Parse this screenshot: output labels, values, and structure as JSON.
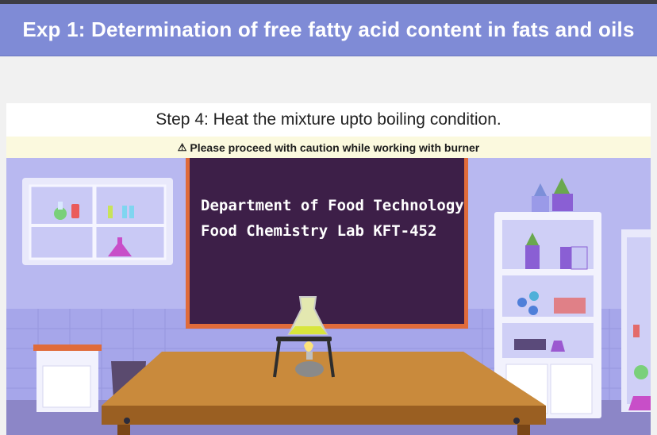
{
  "header": {
    "title": "Exp 1: Determination of free fatty acid content in fats and oils"
  },
  "step": {
    "text": "Step 4: Heat the mixture upto boiling condition."
  },
  "warning": {
    "icon": "warning-triangle-icon",
    "text": "Please proceed with caution while working with burner"
  },
  "chalkboard": {
    "line1": "Department of Food Technology",
    "line2": "Food Chemistry Lab  KFT-452"
  },
  "colors": {
    "header_bg": "#7f8bd6",
    "warning_bg": "#fbf9de",
    "chalkboard": "#3d1f48",
    "wall": "#b9b9f2",
    "table": "#c98a3c"
  }
}
